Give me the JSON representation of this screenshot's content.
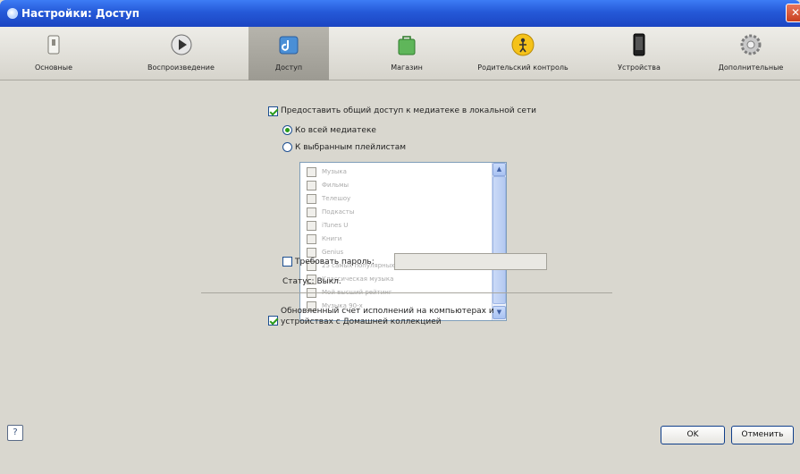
{
  "window": {
    "title": "Настройки: Доступ",
    "close_glyph": "✕"
  },
  "tabs": [
    {
      "label": "Основные",
      "icon": "switch-icon"
    },
    {
      "label": "Воспроизведение",
      "icon": "play-icon"
    },
    {
      "label": "Доступ",
      "icon": "sharing-icon"
    },
    {
      "label": "Магазин",
      "icon": "store-bag-icon"
    },
    {
      "label": "Родительский контроль",
      "icon": "parental-icon"
    },
    {
      "label": "Устройства",
      "icon": "device-icon"
    },
    {
      "label": "Дополнительные",
      "icon": "gear-icon"
    }
  ],
  "sharing": {
    "share_label": "Предоставить общий доступ к медиатеке в локальной сети",
    "share_checked": true,
    "radio_all": "Ко всей медиатеке",
    "radio_selected": "К выбранным плейлистам",
    "playlists": [
      "Музыка",
      "Фильмы",
      "Телешоу",
      "Подкасты",
      "iTunes U",
      "Книги",
      "Genius",
      "25 самых популярных",
      "Классическая музыка",
      "Мой высший рейтинг",
      "Музыка 90-х"
    ],
    "password_label": "Требовать пароль:",
    "password_value": "",
    "status": "Статус: Выкл.",
    "playcount_label_line1": "Обновленный счет исполнений на компьютерах и",
    "playcount_label_line2": "устройствах с Домашней коллекцией",
    "playcount_checked": true
  },
  "footer": {
    "help": "?",
    "ok": "OK",
    "cancel": "Отменить"
  }
}
